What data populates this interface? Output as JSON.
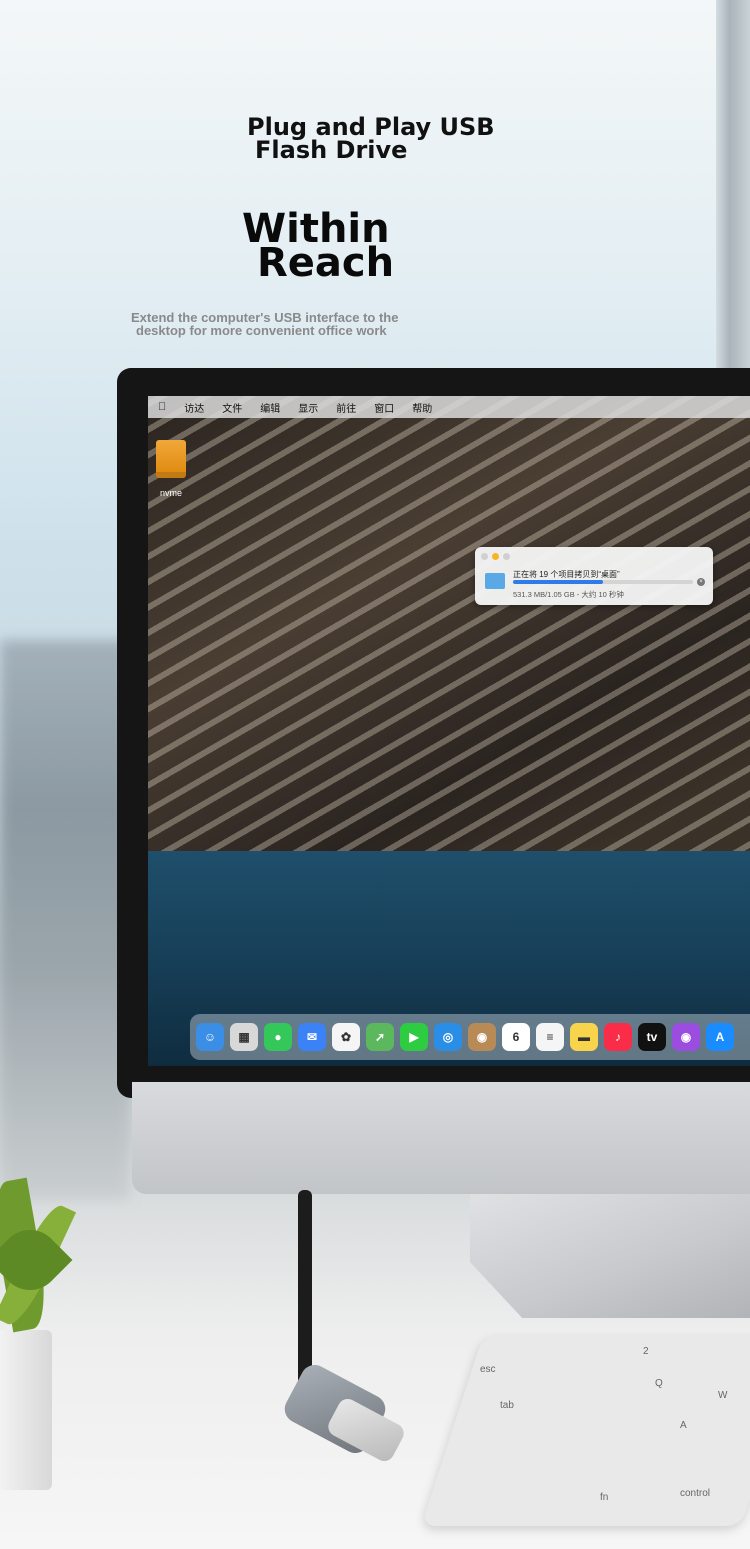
{
  "headline": {
    "line1": "Plug and Play USB",
    "line2": "Flash Drive"
  },
  "big_title": {
    "line1": "Within",
    "line2": "Reach"
  },
  "subtitle": {
    "line1": "Extend the computer's USB interface to the",
    "line2": "desktop for more convenient office work"
  },
  "screen": {
    "menubar": {
      "items": [
        "访达",
        "文件",
        "编辑",
        "显示",
        "前往",
        "窗口",
        "帮助"
      ]
    },
    "desktop_drive_label": "nvme",
    "copy_dialog": {
      "title": "正在将 19 个项目拷贝到“桌面”",
      "status": "531.3 MB/1.05 GB - 大约 10 秒钟",
      "progress": 0.5
    },
    "dock": {
      "apps": [
        {
          "name": "finder",
          "color": "#3a8ee6",
          "glyph": "☺"
        },
        {
          "name": "launchpad",
          "color": "#d8d8d8",
          "glyph": "▦"
        },
        {
          "name": "messages",
          "color": "#34c759",
          "glyph": "●"
        },
        {
          "name": "mail",
          "color": "#3b82f6",
          "glyph": "✉"
        },
        {
          "name": "photos",
          "color": "#f5f5f5",
          "glyph": "✿"
        },
        {
          "name": "maps",
          "color": "#5cb85c",
          "glyph": "➚"
        },
        {
          "name": "facetime",
          "color": "#2ecc40",
          "glyph": "▶"
        },
        {
          "name": "safari",
          "color": "#2b8ee6",
          "glyph": "◎"
        },
        {
          "name": "contacts",
          "color": "#b88a55",
          "glyph": "◉"
        },
        {
          "name": "calendar",
          "color": "#ffffff",
          "glyph": "6"
        },
        {
          "name": "reminders",
          "color": "#f5f5f5",
          "glyph": "≡"
        },
        {
          "name": "notes",
          "color": "#f7d44c",
          "glyph": "▬"
        },
        {
          "name": "music",
          "color": "#fa2d48",
          "glyph": "♪"
        },
        {
          "name": "apple-tv",
          "color": "#111111",
          "glyph": "tv"
        },
        {
          "name": "podcasts",
          "color": "#9b4de0",
          "glyph": "◉"
        },
        {
          "name": "app-store",
          "color": "#1a8cff",
          "glyph": "A"
        }
      ]
    }
  },
  "keyboard": {
    "keys": [
      "esc",
      "tab",
      "Q",
      "W",
      "A",
      "fn",
      "control",
      "2"
    ]
  },
  "colors": {
    "progress": "#2f7bea",
    "drive": "#f0a83a"
  }
}
